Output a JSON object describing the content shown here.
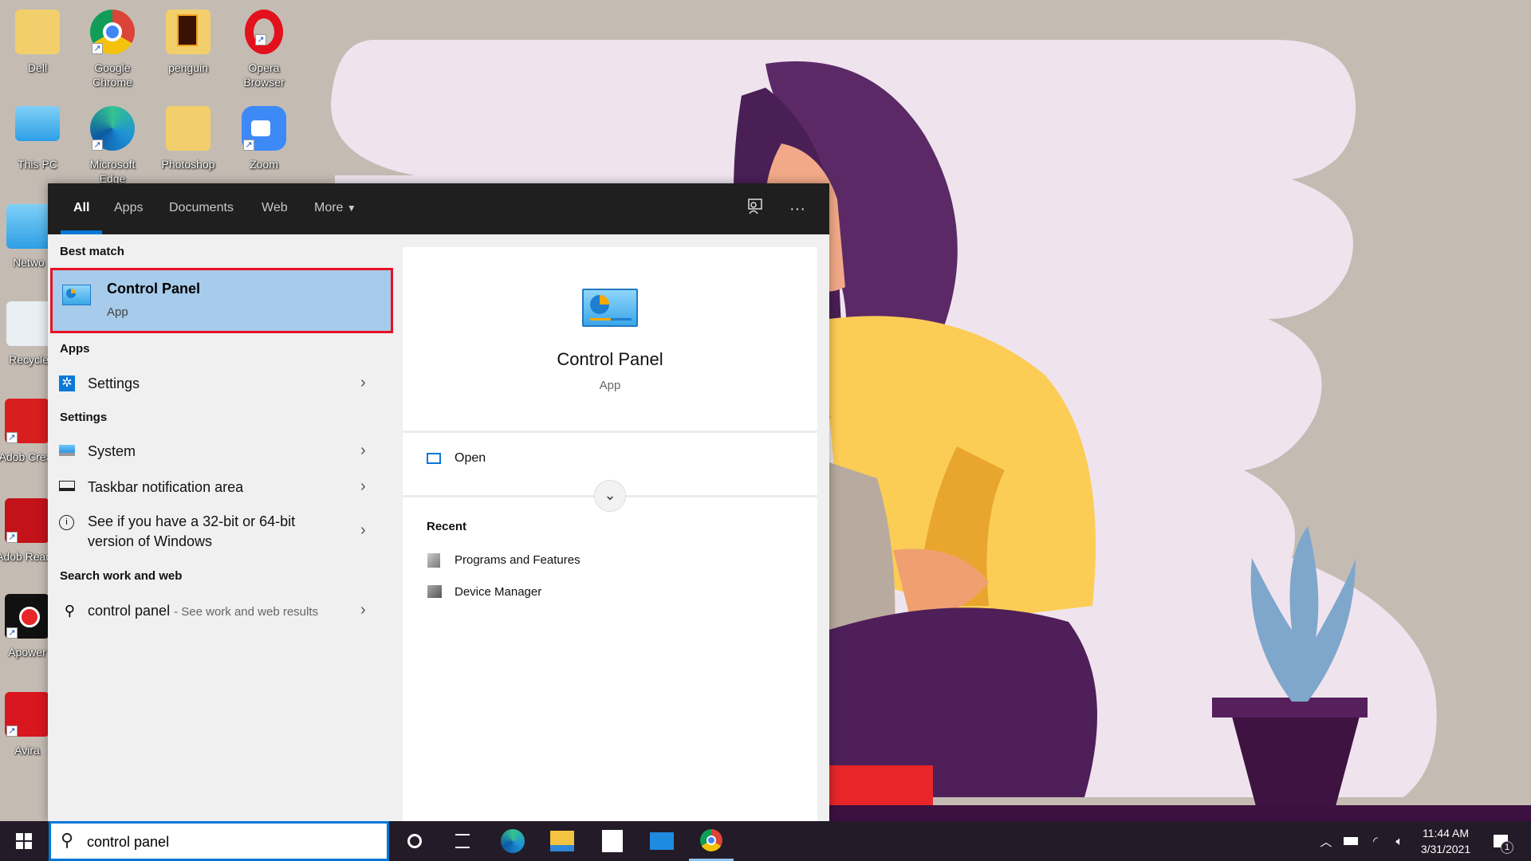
{
  "desktop": {
    "icons": [
      {
        "label": "Dell"
      },
      {
        "label": "Google Chrome"
      },
      {
        "label": "penguin"
      },
      {
        "label": "Opera Browser"
      },
      {
        "label": "This PC"
      },
      {
        "label": "Microsoft Edge"
      },
      {
        "label": "Photoshop"
      },
      {
        "label": "Zoom"
      },
      {
        "label": "Netwo"
      },
      {
        "label": "Recycle"
      },
      {
        "label": "Adob Creat"
      },
      {
        "label": "Adob Reade"
      },
      {
        "label": "Apower"
      },
      {
        "label": "Avira"
      }
    ]
  },
  "search_panel": {
    "tabs": [
      {
        "label": "All"
      },
      {
        "label": "Apps"
      },
      {
        "label": "Documents"
      },
      {
        "label": "Web"
      },
      {
        "label": "More"
      }
    ],
    "active_tab": "All",
    "best_match_header": "Best match",
    "best_match": {
      "title": "Control Panel",
      "subtitle": "App"
    },
    "apps_header": "Apps",
    "apps": [
      {
        "label": "Settings",
        "icon": "gear-icon"
      }
    ],
    "settings_header": "Settings",
    "settings": [
      {
        "label": "System",
        "icon": "monitor-icon"
      },
      {
        "label": "Taskbar notification area",
        "icon": "taskbar-icon"
      },
      {
        "label": "See if you have a 32-bit or 64-bit version of Windows",
        "icon": "info-icon"
      }
    ],
    "web_header": "Search work and web",
    "web": {
      "query": "control panel",
      "hint": "- See work and web results"
    },
    "preview": {
      "title": "Control Panel",
      "subtitle": "App",
      "open_label": "Open",
      "recent_header": "Recent",
      "recent": [
        {
          "label": "Programs and Features"
        },
        {
          "label": "Device Manager"
        }
      ]
    }
  },
  "taskbar": {
    "search_value": "control panel",
    "time": "11:44 AM",
    "date": "3/31/2021",
    "notification_count": "1"
  },
  "colors": {
    "accent": "#0078d7",
    "highlight": "#a7cbea",
    "selection_border": "#e81123"
  }
}
